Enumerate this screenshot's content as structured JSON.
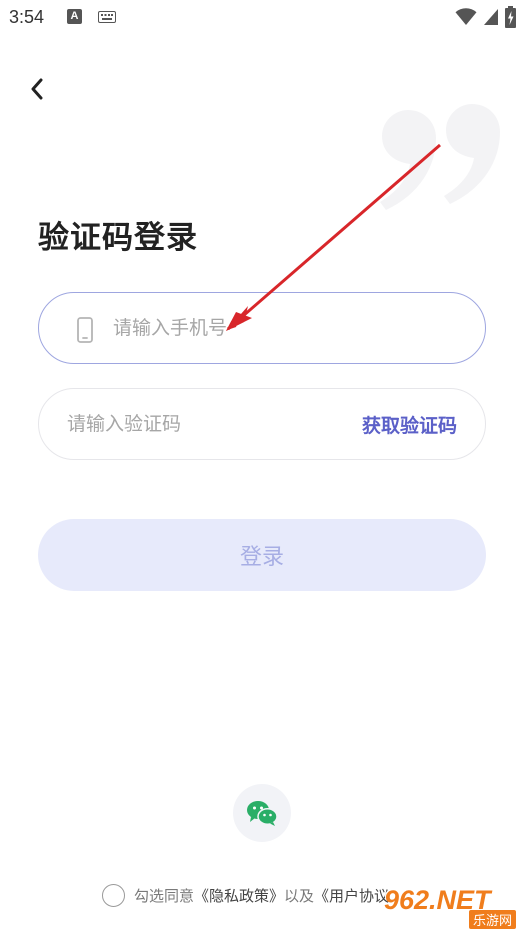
{
  "status_bar": {
    "time": "3:54",
    "notification_icons": [
      "a-icon",
      "keyboard-icon"
    ],
    "system_icons": [
      "wifi-icon",
      "signal-icon",
      "battery-icon"
    ]
  },
  "nav": {
    "back_icon": "chevron-left-icon"
  },
  "page": {
    "title": "验证码登录",
    "decoration_icon": "quote-mark-icon"
  },
  "form": {
    "phone_placeholder": "请输入手机号",
    "phone_value": "",
    "phone_icon": "mobile-phone-icon",
    "code_placeholder": "请输入验证码",
    "code_value": "",
    "get_code_label": "获取验证码",
    "login_label": "登录"
  },
  "social": {
    "wechat_icon": "wechat-icon"
  },
  "agreement": {
    "prefix": "勾选同意",
    "privacy_link": "《隐私政策》",
    "middle": "以及",
    "terms_link": "《用户协议"
  },
  "watermark": {
    "brand": "962.NET",
    "sub": "乐游网"
  },
  "colors": {
    "accent": "#5b60c8",
    "input_border_active": "#9ea6e0",
    "login_bg": "#e7eafb",
    "login_text": "#a7aee4",
    "annotation_arrow": "#d8262a"
  }
}
